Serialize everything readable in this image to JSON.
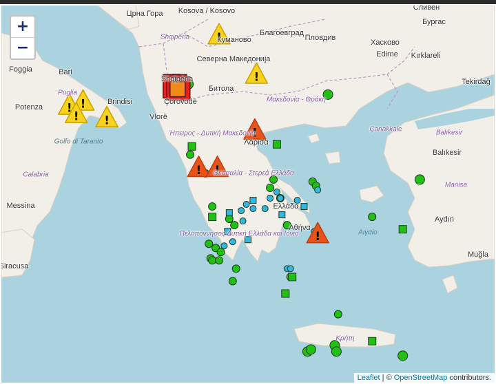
{
  "map": {
    "places": [
      {
        "label": "Црна Гора",
        "style": "city"
      },
      {
        "label": "Kosova / Kosovo",
        "style": "city"
      },
      {
        "label": "Shqipëria",
        "style": "region"
      },
      {
        "label": "Shqipëria",
        "style": "city"
      },
      {
        "label": "Куманово",
        "style": "city"
      },
      {
        "label": "Благоевград",
        "style": "city"
      },
      {
        "label": "Пловдив",
        "style": "city"
      },
      {
        "label": "Хасково",
        "style": "city"
      },
      {
        "label": "Сливен",
        "style": "city"
      },
      {
        "label": "Бургас",
        "style": "city"
      },
      {
        "label": "Edirne",
        "style": "city"
      },
      {
        "label": "Kırklareli",
        "style": "city"
      },
      {
        "label": "Северна Македонија",
        "style": "city"
      },
      {
        "label": "Foggia",
        "style": "city"
      },
      {
        "label": "Bari",
        "style": "city"
      },
      {
        "label": "Puglia",
        "style": "region"
      },
      {
        "label": "Brindisi",
        "style": "city"
      },
      {
        "label": "Potenza",
        "style": "city"
      },
      {
        "label": "Битола",
        "style": "city"
      },
      {
        "label": "Μακεδονία - Θράκη",
        "style": "region"
      },
      {
        "label": "Tekirdağ",
        "style": "city"
      },
      {
        "label": "Vlorë",
        "style": "city"
      },
      {
        "label": "Çorovodë",
        "style": "city"
      },
      {
        "label": "Golfo di Taranto",
        "style": "sea"
      },
      {
        "label": "Ήπειρος - Δυτική Μακεδονία",
        "style": "region"
      },
      {
        "label": "Çanakkale",
        "style": "region"
      },
      {
        "label": "Balıkesir",
        "style": "region"
      },
      {
        "label": "Balıkesir",
        "style": "city"
      },
      {
        "label": "Λάρισα",
        "style": "city"
      },
      {
        "label": "Calabria",
        "style": "region"
      },
      {
        "label": "Θεσσαλία - Στερεά Ελλάδα",
        "style": "region"
      },
      {
        "label": "Messina",
        "style": "city"
      },
      {
        "label": "Ελλάδα",
        "style": "city"
      },
      {
        "label": "Manisa",
        "style": "region"
      },
      {
        "label": "Πελοπόννησος Δυτική Ελλάδα και Ιόνιο",
        "style": "region"
      },
      {
        "label": "Αθήνα",
        "style": "city"
      },
      {
        "label": "Αιγαίο",
        "style": "sea"
      },
      {
        "label": "Aydın",
        "style": "city"
      },
      {
        "label": "Siracusa",
        "style": "city"
      },
      {
        "label": "Muğla",
        "style": "city"
      },
      {
        "label": "Κρήτη",
        "style": "region"
      }
    ],
    "markers": [
      {
        "type": "warning",
        "severity": "yellow",
        "lon": 20.9,
        "lat": 42.7
      },
      {
        "type": "warning",
        "severity": "yellow",
        "lon": 22.0,
        "lat": 41.75
      },
      {
        "type": "warning",
        "severity": "yellow",
        "lon": 16.5,
        "lat": 41.0
      },
      {
        "type": "warning",
        "severity": "yellow",
        "lon": 16.9,
        "lat": 41.1
      },
      {
        "type": "warning",
        "severity": "yellow",
        "lon": 16.7,
        "lat": 40.8
      },
      {
        "type": "warning",
        "severity": "yellow",
        "lon": 17.6,
        "lat": 40.7
      },
      {
        "type": "warning",
        "severity": "orange",
        "lon": 21.95,
        "lat": 40.4
      },
      {
        "type": "warning",
        "severity": "orange",
        "lon": 20.3,
        "lat": 39.5
      },
      {
        "type": "warning",
        "severity": "orange",
        "lon": 20.85,
        "lat": 39.5
      },
      {
        "type": "warning",
        "severity": "orange",
        "lon": 23.8,
        "lat": 37.9
      },
      {
        "type": "alert-square",
        "severity": "red",
        "lon": 19.6,
        "lat": 41.45
      },
      {
        "type": "alert-square",
        "severity": "red",
        "lon": 19.7,
        "lat": 41.4
      },
      {
        "type": "alert-square",
        "severity": "orange",
        "lon": 19.68,
        "lat": 41.38
      },
      {
        "type": "station-square",
        "severity": "green",
        "lon": 19.65,
        "lat": 41.65
      },
      {
        "type": "station-square",
        "severity": "green",
        "lon": 20.1,
        "lat": 40.0
      },
      {
        "type": "station-square",
        "severity": "green",
        "lon": 22.6,
        "lat": 40.05
      },
      {
        "type": "station-square",
        "severity": "green",
        "lon": 20.7,
        "lat": 38.3
      },
      {
        "type": "station-square",
        "severity": "green",
        "lon": 23.05,
        "lat": 36.85
      },
      {
        "type": "station-square",
        "severity": "green",
        "lon": 22.85,
        "lat": 36.45
      },
      {
        "type": "station-square",
        "severity": "green",
        "lon": 26.3,
        "lat": 38.0
      },
      {
        "type": "station-square",
        "severity": "green",
        "lon": 25.4,
        "lat": 35.3
      },
      {
        "type": "station-square",
        "severity": "blue",
        "lon": 21.9,
        "lat": 38.7
      },
      {
        "type": "station-square",
        "severity": "blue",
        "lon": 21.2,
        "lat": 38.4
      },
      {
        "type": "station-square",
        "severity": "blue",
        "lon": 22.75,
        "lat": 38.35
      },
      {
        "type": "station-square",
        "severity": "blue",
        "lon": 23.4,
        "lat": 38.55
      },
      {
        "type": "station-square",
        "severity": "blue",
        "lon": 21.75,
        "lat": 37.75
      },
      {
        "type": "station-square",
        "severity": "blue",
        "lon": 21.15,
        "lat": 37.95
      },
      {
        "type": "station-circle",
        "severity": "green",
        "lon": 20.0,
        "lat": 41.5
      },
      {
        "type": "station-circle",
        "severity": "green",
        "lon": 24.1,
        "lat": 41.25
      },
      {
        "type": "station-circle",
        "severity": "green",
        "lon": 20.05,
        "lat": 39.8
      },
      {
        "type": "station-circle",
        "severity": "green",
        "lon": 20.3,
        "lat": 39.55
      },
      {
        "type": "station-circle",
        "severity": "green",
        "lon": 20.5,
        "lat": 39.35
      },
      {
        "type": "station-circle",
        "severity": "green",
        "lon": 22.5,
        "lat": 39.2
      },
      {
        "type": "station-circle",
        "severity": "green",
        "lon": 22.4,
        "lat": 39.0
      },
      {
        "type": "station-circle",
        "severity": "green",
        "lon": 23.65,
        "lat": 39.15
      },
      {
        "type": "station-circle",
        "severity": "green",
        "lon": 23.75,
        "lat": 39.05
      },
      {
        "type": "station-circle",
        "severity": "green",
        "lon": 26.8,
        "lat": 39.2
      },
      {
        "type": "station-circle",
        "severity": "green",
        "lon": 22.7,
        "lat": 38.75
      },
      {
        "type": "station-circle",
        "severity": "green",
        "lon": 20.7,
        "lat": 38.55
      },
      {
        "type": "station-circle",
        "severity": "green",
        "lon": 21.2,
        "lat": 38.25
      },
      {
        "type": "station-circle",
        "severity": "green",
        "lon": 21.35,
        "lat": 38.1
      },
      {
        "type": "station-circle",
        "severity": "green",
        "lon": 25.4,
        "lat": 38.3
      },
      {
        "type": "station-circle",
        "severity": "green",
        "lon": 22.9,
        "lat": 38.1
      },
      {
        "type": "station-circle",
        "severity": "green",
        "lon": 20.6,
        "lat": 37.65
      },
      {
        "type": "station-circle",
        "severity": "green",
        "lon": 20.8,
        "lat": 37.55
      },
      {
        "type": "station-circle",
        "severity": "green",
        "lon": 20.95,
        "lat": 37.45
      },
      {
        "type": "station-circle",
        "severity": "green",
        "lon": 20.65,
        "lat": 37.3
      },
      {
        "type": "station-circle",
        "severity": "green",
        "lon": 20.7,
        "lat": 37.25
      },
      {
        "type": "station-circle",
        "severity": "green",
        "lon": 20.9,
        "lat": 37.25
      },
      {
        "type": "station-circle",
        "severity": "green",
        "lon": 21.4,
        "lat": 37.05
      },
      {
        "type": "station-circle",
        "severity": "green",
        "lon": 21.3,
        "lat": 36.75
      },
      {
        "type": "station-circle",
        "severity": "green",
        "lon": 23.0,
        "lat": 36.85
      },
      {
        "type": "station-circle",
        "severity": "green",
        "lon": 24.4,
        "lat": 35.95
      },
      {
        "type": "station-circle",
        "severity": "green",
        "lon": 23.5,
        "lat": 35.05
      },
      {
        "type": "station-circle",
        "severity": "green",
        "lon": 23.6,
        "lat": 35.1
      },
      {
        "type": "station-circle",
        "severity": "green",
        "lon": 24.3,
        "lat": 35.2
      },
      {
        "type": "station-circle",
        "severity": "green",
        "lon": 24.35,
        "lat": 35.05
      },
      {
        "type": "station-circle",
        "severity": "green",
        "lon": 26.3,
        "lat": 34.95
      },
      {
        "type": "station-circle",
        "severity": "blue",
        "lon": 23.8,
        "lat": 38.95
      },
      {
        "type": "station-circle",
        "severity": "blue",
        "lon": 22.6,
        "lat": 38.9
      },
      {
        "type": "station-circle",
        "severity": "blue",
        "lon": 22.4,
        "lat": 38.75
      },
      {
        "type": "station-circle",
        "severity": "blue",
        "lon": 22.7,
        "lat": 38.75
      },
      {
        "type": "station-circle",
        "severity": "blue",
        "lon": 23.2,
        "lat": 38.7
      },
      {
        "type": "station-circle",
        "severity": "blue",
        "lon": 21.7,
        "lat": 38.6
      },
      {
        "type": "station-circle",
        "severity": "blue",
        "lon": 21.9,
        "lat": 38.5
      },
      {
        "type": "station-circle",
        "severity": "blue",
        "lon": 22.25,
        "lat": 38.5
      },
      {
        "type": "station-circle",
        "severity": "blue",
        "lon": 21.55,
        "lat": 38.45
      },
      {
        "type": "station-circle",
        "severity": "blue",
        "lon": 21.6,
        "lat": 38.2
      },
      {
        "type": "station-circle",
        "severity": "blue",
        "lon": 21.3,
        "lat": 37.7
      },
      {
        "type": "station-circle",
        "severity": "blue",
        "lon": 21.05,
        "lat": 37.6
      },
      {
        "type": "station-circle",
        "severity": "blue",
        "lon": 23.7,
        "lat": 37.95
      },
      {
        "type": "station-circle",
        "severity": "blue",
        "lon": 23.8,
        "lat": 37.9
      },
      {
        "type": "station-circle",
        "severity": "blue",
        "lon": 22.9,
        "lat": 37.05
      },
      {
        "type": "station-circle",
        "severity": "blue",
        "lon": 23.0,
        "lat": 37.05
      }
    ],
    "colors": {
      "sea": "#aad3df",
      "land": "#f2efe9",
      "green": "#22c015",
      "blue": "#35b6e0",
      "yellow": "#f7d21e",
      "orange": "#f08a1a",
      "orange_red": "#e8531a",
      "red": "#e4221b"
    }
  },
  "zoom": {
    "in": "+",
    "out": "−"
  },
  "attribution": {
    "leaflet": "Leaflet",
    "separator": " | © ",
    "osm": "OpenStreetMap",
    "suffix": " contributors."
  }
}
